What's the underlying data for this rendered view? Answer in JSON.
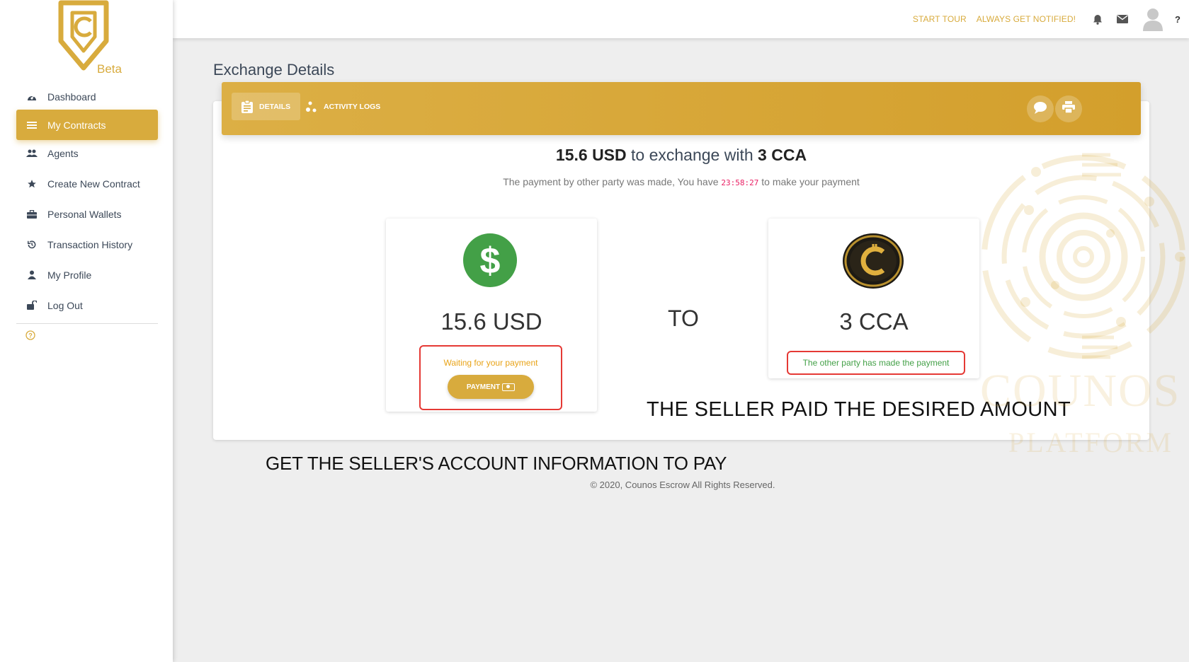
{
  "brand": {
    "beta_label": "Beta",
    "accent_color": "#d8ab3d"
  },
  "sidebar": {
    "items": [
      {
        "label": "Dashboard",
        "icon": "dashboard-icon"
      },
      {
        "label": "My Contracts",
        "icon": "list-icon",
        "active": true
      },
      {
        "label": "Agents",
        "icon": "users-icon"
      },
      {
        "label": "Create New Contract",
        "icon": "star-icon"
      },
      {
        "label": "Personal Wallets",
        "icon": "briefcase-icon"
      },
      {
        "label": "Transaction History",
        "icon": "history-icon"
      },
      {
        "label": "My Profile",
        "icon": "user-icon"
      },
      {
        "label": "Log Out",
        "icon": "unlock-icon"
      }
    ],
    "help_icon": "help-icon"
  },
  "topbar": {
    "start_tour": "START TOUR",
    "notified": "ALWAYS GET NOTIFIED!",
    "help": "?"
  },
  "page": {
    "title": "Exchange Details"
  },
  "tabs": {
    "details": "DETAILS",
    "activity": "ACTIVITY LOGS"
  },
  "exchange": {
    "from_amount": "15.6 USD",
    "middle": "to exchange with",
    "to_amount": "3 CCA",
    "sub_before": "The payment by other party was made, You have",
    "countdown": "23:58:27",
    "sub_after": "to make your payment",
    "usd_card_amount": "15.6 USD",
    "cca_card_amount": "3 CCA",
    "to_label": "TO",
    "waiting": "Waiting for your payment",
    "pay_button": "PAYMENT",
    "other_paid": "The other party has made the payment"
  },
  "annotations": {
    "seller_paid": "THE SELLER PAID THE DESIRED AMOUNT",
    "get_info": "GET THE SELLER'S ACCOUNT INFORMATION TO PAY"
  },
  "footer": {
    "copyright": "© 2020, Counos Escrow All Rights Reserved."
  },
  "watermark": {
    "line1": "COUNOS",
    "line2": "PLATFORM"
  }
}
